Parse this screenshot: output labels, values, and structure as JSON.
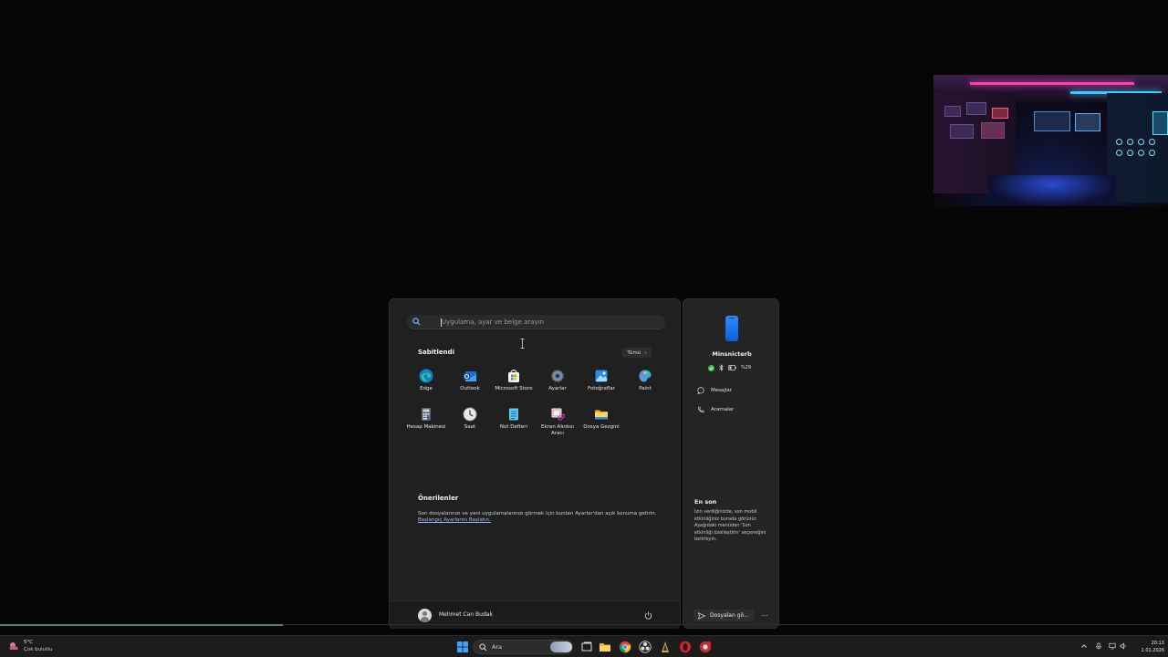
{
  "start_menu": {
    "search_placeholder": "Uygulama, ayar ve belge arayın",
    "pinned_title": "Sabitlendi",
    "all_button": "Tümü",
    "pinned_apps": [
      {
        "label": "Edge",
        "icon": "edge-icon"
      },
      {
        "label": "Outlook",
        "icon": "outlook-icon"
      },
      {
        "label": "Microsoft Store",
        "icon": "store-icon"
      },
      {
        "label": "Ayarlar",
        "icon": "settings-gear-icon"
      },
      {
        "label": "Fotoğraflar",
        "icon": "photos-icon"
      },
      {
        "label": "Paint",
        "icon": "paint-icon"
      },
      {
        "label": "Hesap Makinesi",
        "icon": "calculator-icon"
      },
      {
        "label": "Saat",
        "icon": "clock-icon"
      },
      {
        "label": "Not Defteri",
        "icon": "notepad-icon"
      },
      {
        "label": "Ekran Alıntısı Aracı",
        "icon": "snipping-tool-icon"
      },
      {
        "label": "Dosya Gezgini",
        "icon": "folder-icon"
      }
    ],
    "recommended_title": "Önerilenler",
    "recommended_text": "Son dosyalarınızı ve yeni uygulamalarınızı görmek için bunları Ayarlar'dan açık konuma getirin.",
    "recommended_link": "Başlangıç Ayarlarını Başlatın.",
    "user_name": "Mehmet Can Budak"
  },
  "phone_panel": {
    "device_name": "Minsnicterb",
    "battery": "%29",
    "messages_label": "Mesajlar",
    "calls_label": "Aramalar",
    "recent_title": "En son",
    "recent_text": "İzin verdiğinizde, son mobil etkinliğiniz burada görünür. Aşağıdaki menüden 'Son etkinliği özelleştirin' seçeneğini belirleyin.",
    "send_files_label": "Dosyalan gö...",
    "more_label": "···"
  },
  "taskbar": {
    "weather_temp": "5°C",
    "weather_desc": "Çok bulutlu",
    "search_label": "Ara",
    "time": "20:13",
    "date": "1.01.2026"
  },
  "colors": {
    "accent_blue": "#2f8cff",
    "status_green": "#3cc24a",
    "panel_bg": "#202020"
  }
}
